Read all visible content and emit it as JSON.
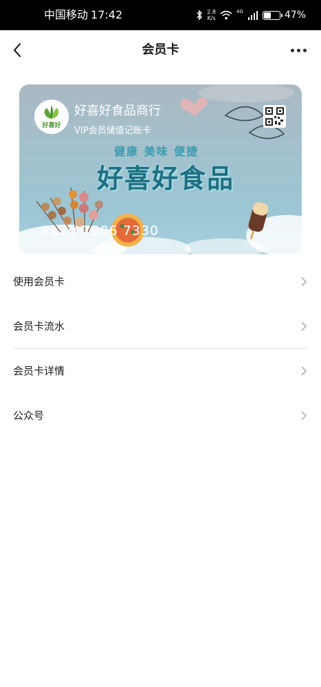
{
  "status_bar": {
    "carrier": "中国移动",
    "time": "17:42",
    "speed_value": "2.8",
    "speed_unit": "K/s",
    "network": "4G",
    "battery_percent": "47%",
    "battery_level": 0.47
  },
  "nav": {
    "title": "会员卡",
    "back_icon": "chevron-left-icon",
    "more_icon": "more-dots-icon"
  },
  "card": {
    "merchant_name": "好喜好食品商行",
    "card_type": "VIP会员储值记账卡",
    "logo_text": "好喜好",
    "slogan": "健康 美味 便捷",
    "brand": "好喜好食品",
    "card_number": "1120 7306 7330",
    "qr_icon": "qr-code-icon",
    "colors": {
      "brand": "#1f6f83",
      "slogan": "#3a9bb0",
      "logo_green": "#4a9a2e"
    }
  },
  "menu": {
    "items": [
      {
        "label": "使用会员卡"
      },
      {
        "label": "会员卡流水"
      },
      {
        "label": "会员卡详情"
      },
      {
        "label": "公众号"
      }
    ]
  }
}
